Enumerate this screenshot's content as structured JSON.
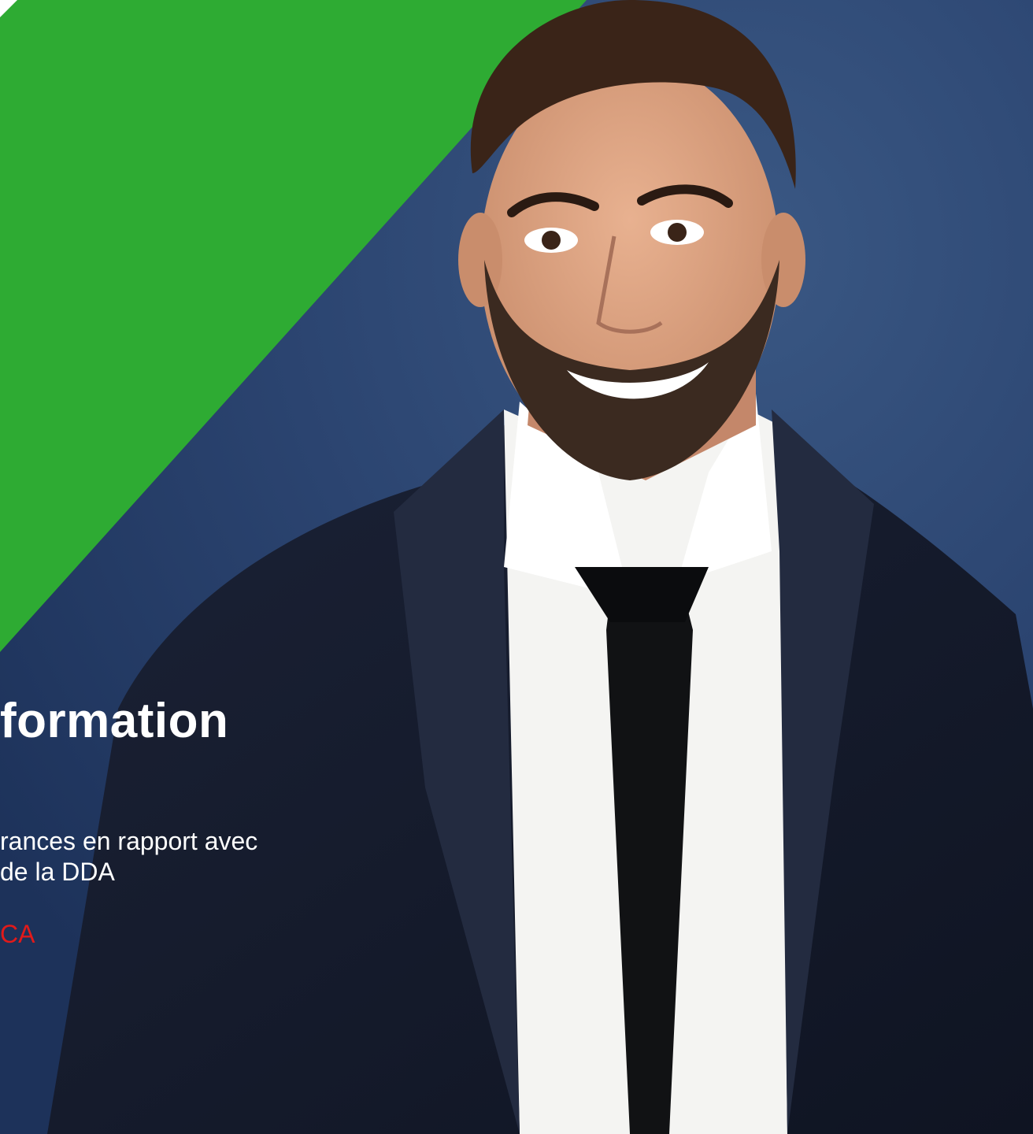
{
  "slide": {
    "title": "formation",
    "subtitle_lines": [
      "rances en rapport avec",
      "de la DDA"
    ],
    "organization": "CA"
  },
  "colors": {
    "background": "#2b4470",
    "accent_band": "#2eab33",
    "corner": "#ffffff",
    "title_text": "#ffffff",
    "subtitle_text": "#ffffff",
    "organization_text": "#e11a1a"
  },
  "image": {
    "icon": "portrait-photo"
  }
}
